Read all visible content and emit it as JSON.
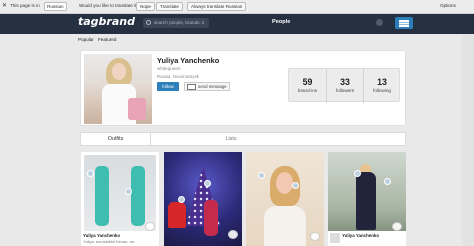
{
  "translate_bar": {
    "close": "✕",
    "prefix": "This page is in",
    "language": "Russian",
    "question": "Would you like to translate it?",
    "nope": "Nope",
    "translate": "Translate",
    "always": "Always translate Russian",
    "options": "Options"
  },
  "header": {
    "logo": "tagbrand",
    "search_placeholder": "search people, brands, it",
    "nav_people": "People"
  },
  "subnav": {
    "popular": "Popular",
    "featured": "Featured"
  },
  "profile": {
    "name": "Yuliya Yanchenko",
    "handle": "whitequeen",
    "location": "Russia, Novorossiysk",
    "follow_label": "follow",
    "message_label": "send message",
    "stats": [
      {
        "value": "59",
        "label": "brand-ins"
      },
      {
        "value": "33",
        "label": "followers"
      },
      {
        "value": "13",
        "label": "following"
      }
    ]
  },
  "tabs": {
    "outfits": "Outfits",
    "lists": "Lists"
  },
  "cards": [
    {
      "name": "Yuliya Yanchenko",
      "desc": "Yuliya, euroskibkil Kirvan, vie"
    },
    {
      "name": "",
      "desc": ""
    },
    {
      "name": "",
      "desc": ""
    },
    {
      "name": "Yuliya Yanchenko",
      "desc": ""
    }
  ],
  "colors": {
    "header_bg": "#253040",
    "accent": "#2c7fb8"
  }
}
